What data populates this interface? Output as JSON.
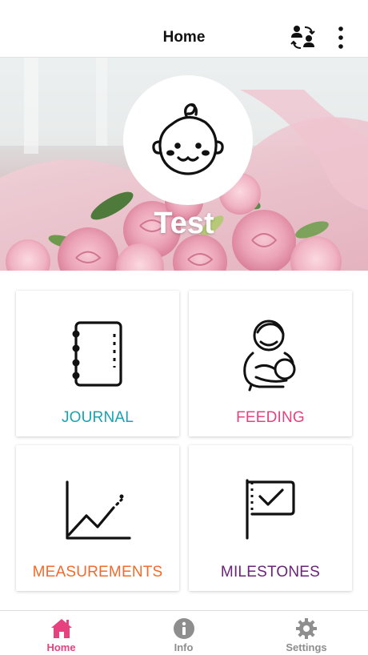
{
  "header": {
    "title": "Home",
    "switch_icon": "switch-user-icon",
    "more_icon": "more-vertical-icon"
  },
  "hero": {
    "baby_name": "Test",
    "avatar_icon": "baby-face-icon"
  },
  "tiles": [
    {
      "label": "JOURNAL",
      "icon": "journal-icon",
      "color": "#17a3b0"
    },
    {
      "label": "FEEDING",
      "icon": "breastfeeding-icon",
      "color": "#e8417f"
    },
    {
      "label": "MEASUREMENTS",
      "icon": "growth-chart-icon",
      "color": "#f26b2c"
    },
    {
      "label": "MILESTONES",
      "icon": "milestone-flag-icon",
      "color": "#6a2479"
    }
  ],
  "tabbar": {
    "active_color": "#e8417f",
    "inactive_color": "#8e8e8e",
    "items": [
      {
        "label": "Home",
        "icon": "home-icon",
        "active": true
      },
      {
        "label": "Info",
        "icon": "info-icon",
        "active": false
      },
      {
        "label": "Settings",
        "icon": "gear-icon",
        "active": false
      }
    ]
  }
}
